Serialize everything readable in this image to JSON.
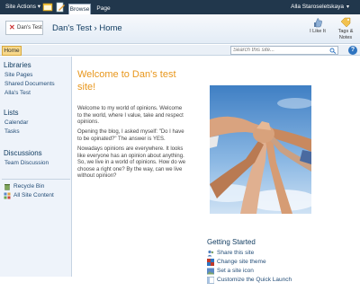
{
  "ribbon": {
    "site_actions": "Site Actions",
    "tabs": [
      {
        "label": "Browse"
      },
      {
        "label": "Page"
      }
    ],
    "user": "Alla Staroseletskaya"
  },
  "title_area": {
    "logo_label": "Dan's Test",
    "site_title": "Dan's Test",
    "separator": "›",
    "page_title": "Home",
    "buttons": [
      {
        "label": "I Like It"
      },
      {
        "label": "Tags &",
        "label2": "Notes"
      }
    ]
  },
  "quick_bar": {
    "home_tab": "Home",
    "search_placeholder": "Search this site..."
  },
  "left_nav": {
    "libraries_heading": "Libraries",
    "libraries": [
      "Site Pages",
      "Shared Documents",
      "Alla's Test"
    ],
    "lists_heading": "Lists",
    "lists": [
      "Calendar",
      "Tasks"
    ],
    "discussions_heading": "Discussions",
    "discussions": [
      "Team Discussion"
    ],
    "footer": [
      "Recycle Bin",
      "All Site Content"
    ]
  },
  "main": {
    "welcome_line1": "Welcome to Dan's test",
    "welcome_line2": "site!",
    "paragraphs": [
      [
        "Welcome to my world of opinions. Welcome",
        "to the world, where I value, take and respect",
        "opinions."
      ],
      [
        "Opening the blog, I asked myself: \"Do I have",
        "to be opinated?\" The answer is YES."
      ],
      [
        "Nowadays opinions are everywhere. It looks",
        "like everyone has an opinion about anything.",
        "So, we live in a world of opinions. How do we",
        "choose a right one? By the way, can we live",
        "without opinion?"
      ]
    ]
  },
  "getting_started": {
    "title": "Getting Started",
    "items": [
      "Share this site",
      "Change site theme",
      "Set a site icon",
      "Customize the Quick Launch"
    ]
  }
}
